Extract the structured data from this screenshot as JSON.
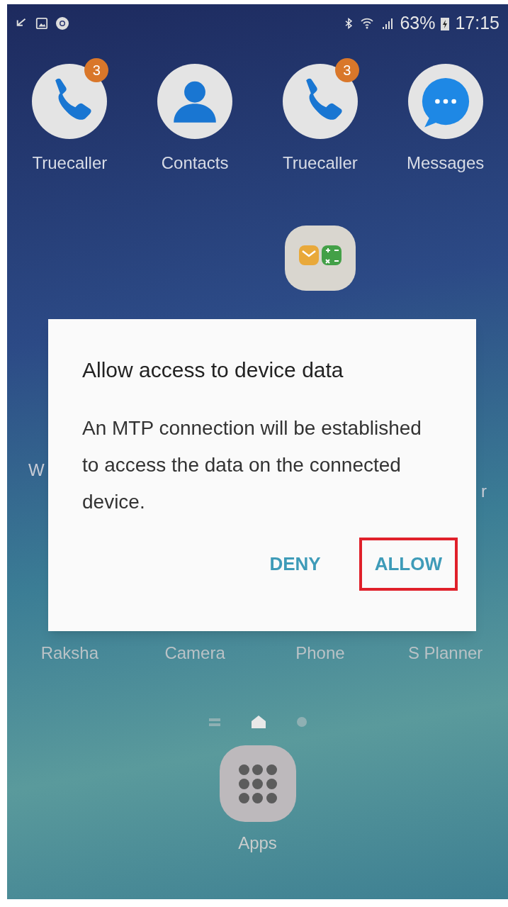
{
  "status_bar": {
    "battery": "63%",
    "time": "17:15"
  },
  "top_apps": [
    {
      "label": "Truecaller",
      "kind": "phone",
      "badge": "3"
    },
    {
      "label": "Contacts",
      "kind": "contact"
    },
    {
      "label": "Truecaller",
      "kind": "phone",
      "badge": "3"
    },
    {
      "label": "Messages",
      "kind": "message"
    }
  ],
  "middle_row_labels": [
    "W",
    "r"
  ],
  "bottom_apps": [
    {
      "label": "Raksha"
    },
    {
      "label": "Camera"
    },
    {
      "label": "Phone"
    },
    {
      "label": "S Planner"
    }
  ],
  "page_indicator": [
    {
      "kind": "list",
      "selected": false
    },
    {
      "kind": "home",
      "selected": true
    },
    {
      "kind": "dot",
      "selected": false
    }
  ],
  "apps_button": {
    "label": "Apps"
  },
  "dialog": {
    "title": "Allow access to device data",
    "message": "An MTP connection will be established to access the data on the connected device.",
    "buttons": [
      {
        "label": "DENY",
        "highlighted": false
      },
      {
        "label": "ALLOW",
        "highlighted": true
      }
    ]
  }
}
